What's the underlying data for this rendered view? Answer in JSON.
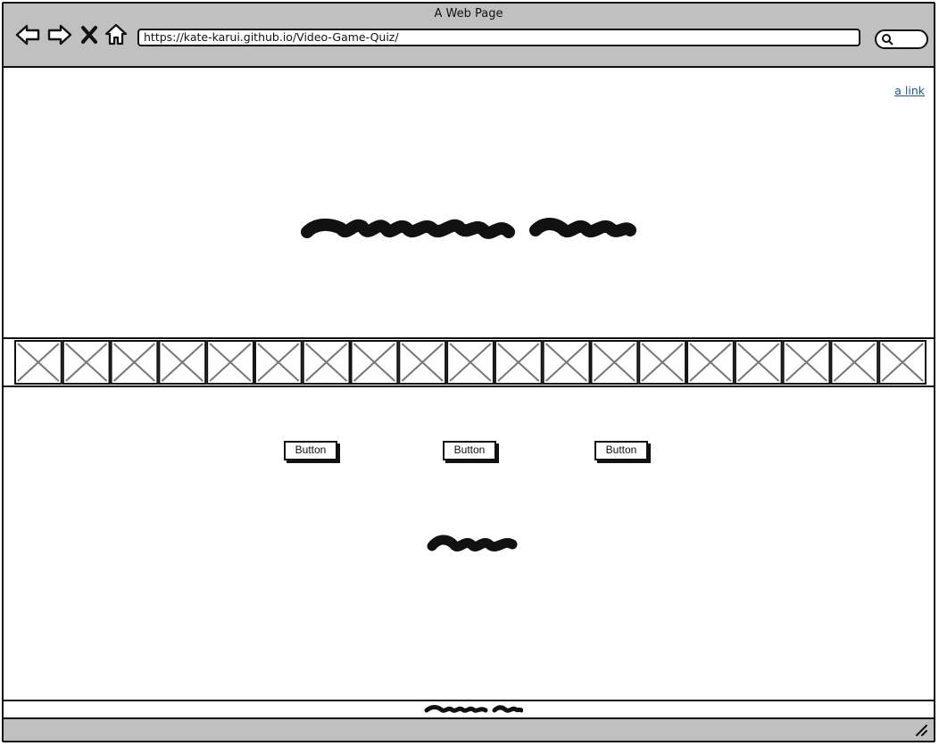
{
  "window": {
    "title": "A Web Page",
    "url": "https://kate-karui.github.io/Video-Game-Quiz/"
  },
  "icons": {
    "back": "back-arrow-icon",
    "forward": "forward-arrow-icon",
    "close": "close-icon",
    "home": "home-icon",
    "search": "search-icon",
    "resize": "resize-grip-icon"
  },
  "page": {
    "top_link": "a link",
    "heading_placeholder": "scribbled heading text",
    "image_strip_count": 19,
    "buttons": [
      "Button",
      "Button",
      "Button"
    ],
    "subtext_placeholder": "scribbled text"
  },
  "colors": {
    "chrome": "#c0c0c0",
    "link": "#1a5a9a",
    "ink": "#111111"
  }
}
